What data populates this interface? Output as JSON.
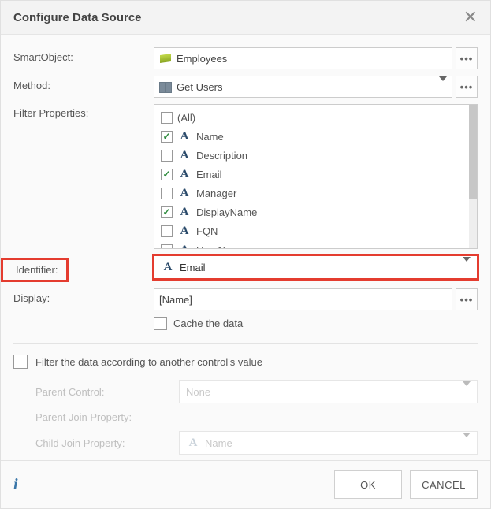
{
  "header": {
    "title": "Configure Data Source"
  },
  "labels": {
    "smartobject": "SmartObject:",
    "method": "Method:",
    "filter_properties": "Filter Properties:",
    "identifier": "Identifier:",
    "display": "Display:",
    "cache": "Cache the data",
    "filter_by": "Filter the data according to another control's value",
    "parent_control": "Parent Control:",
    "parent_join": "Parent Join Property:",
    "child_join": "Child Join Property:"
  },
  "values": {
    "smartobject": "Employees",
    "method": "Get Users",
    "identifier": "Email",
    "display": "[Name]",
    "parent_control": "None",
    "child_join": "Name"
  },
  "filter_items": [
    {
      "label": "(All)",
      "checked": false,
      "has_type_icon": false
    },
    {
      "label": "Name",
      "checked": true,
      "has_type_icon": true
    },
    {
      "label": "Description",
      "checked": false,
      "has_type_icon": true
    },
    {
      "label": "Email",
      "checked": true,
      "has_type_icon": true
    },
    {
      "label": "Manager",
      "checked": false,
      "has_type_icon": true
    },
    {
      "label": "DisplayName",
      "checked": true,
      "has_type_icon": true
    },
    {
      "label": "FQN",
      "checked": false,
      "has_type_icon": true
    },
    {
      "label": "UserName",
      "checked": false,
      "has_type_icon": true
    }
  ],
  "checks": {
    "cache": false,
    "filter_by": false
  },
  "buttons": {
    "ok": "OK",
    "cancel": "CANCEL"
  }
}
